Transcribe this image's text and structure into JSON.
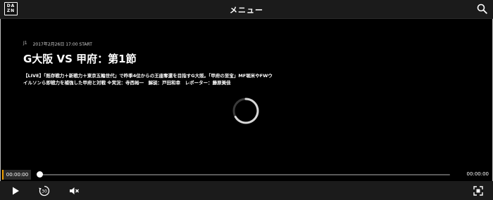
{
  "header": {
    "logo": [
      "DA",
      "ZN"
    ],
    "title": "メニュー"
  },
  "video": {
    "competition": "J1",
    "datetime": "2017年2月26日 17:00 START",
    "title": "G大阪 VS 甲府：第1節",
    "description": "【LIVE】「既存戦力＋新戦力＋東京五輪世代」で昨季4位からの王座奪還を目指すG大阪。「甲府の至宝」MF堀米やFWウイルソンら即戦力を補強した甲府と対戦 ※実況：寺西裕一　解説：戸田和幸　レポーター：藤原美佳"
  },
  "player": {
    "current_time": "00:00:00",
    "duration": "00:00:00",
    "progress": 0,
    "skip_seconds": "30"
  }
}
